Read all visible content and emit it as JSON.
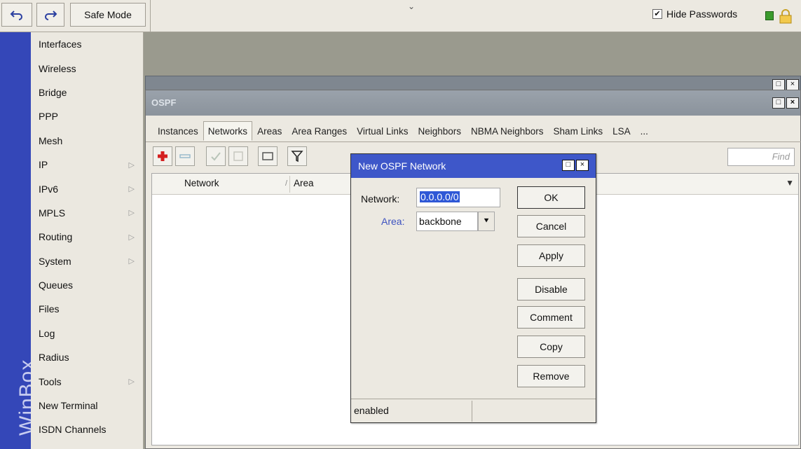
{
  "toolbar": {
    "undo_icon": "undo-icon",
    "redo_icon": "redo-icon",
    "safe_mode_label": "Safe Mode",
    "hide_passwords_label": "Hide Passwords",
    "hide_passwords_checked": "✔"
  },
  "brand": {
    "text": "WinBox"
  },
  "menu": {
    "items": [
      {
        "label": "Interfaces",
        "arrow": ""
      },
      {
        "label": "Wireless",
        "arrow": ""
      },
      {
        "label": "Bridge",
        "arrow": ""
      },
      {
        "label": "PPP",
        "arrow": ""
      },
      {
        "label": "Mesh",
        "arrow": ""
      },
      {
        "label": "IP",
        "arrow": "▷"
      },
      {
        "label": "IPv6",
        "arrow": "▷"
      },
      {
        "label": "MPLS",
        "arrow": "▷"
      },
      {
        "label": "Routing",
        "arrow": "▷"
      },
      {
        "label": "System",
        "arrow": "▷"
      },
      {
        "label": "Queues",
        "arrow": ""
      },
      {
        "label": "Files",
        "arrow": ""
      },
      {
        "label": "Log",
        "arrow": ""
      },
      {
        "label": "Radius",
        "arrow": ""
      },
      {
        "label": "Tools",
        "arrow": "▷"
      },
      {
        "label": "New Terminal",
        "arrow": ""
      },
      {
        "label": "ISDN Channels",
        "arrow": ""
      }
    ]
  },
  "ospf": {
    "title": "OSPF",
    "tabs": [
      "Instances",
      "Networks",
      "Areas",
      "Area Ranges",
      "Virtual Links",
      "Neighbors",
      "NBMA Neighbors",
      "Sham Links",
      "LSA",
      "..."
    ],
    "active_tab": "Networks",
    "find_placeholder": "Find",
    "columns": {
      "network": "Network",
      "sort": "/",
      "area": "Area"
    }
  },
  "dialog": {
    "title": "New OSPF Network",
    "network_label": "Network:",
    "network_value": "0.0.0.0/0",
    "area_label": "Area:",
    "area_value": "backbone",
    "buttons": {
      "ok": "OK",
      "cancel": "Cancel",
      "apply": "Apply",
      "disable": "Disable",
      "comment": "Comment",
      "copy": "Copy",
      "remove": "Remove"
    },
    "status": "enabled"
  },
  "colors": {
    "brand_bar": "#3447b8",
    "dialog_title": "#3e57c9",
    "ospf_title": "#8b939c",
    "workspace": "#9a9a8e"
  }
}
